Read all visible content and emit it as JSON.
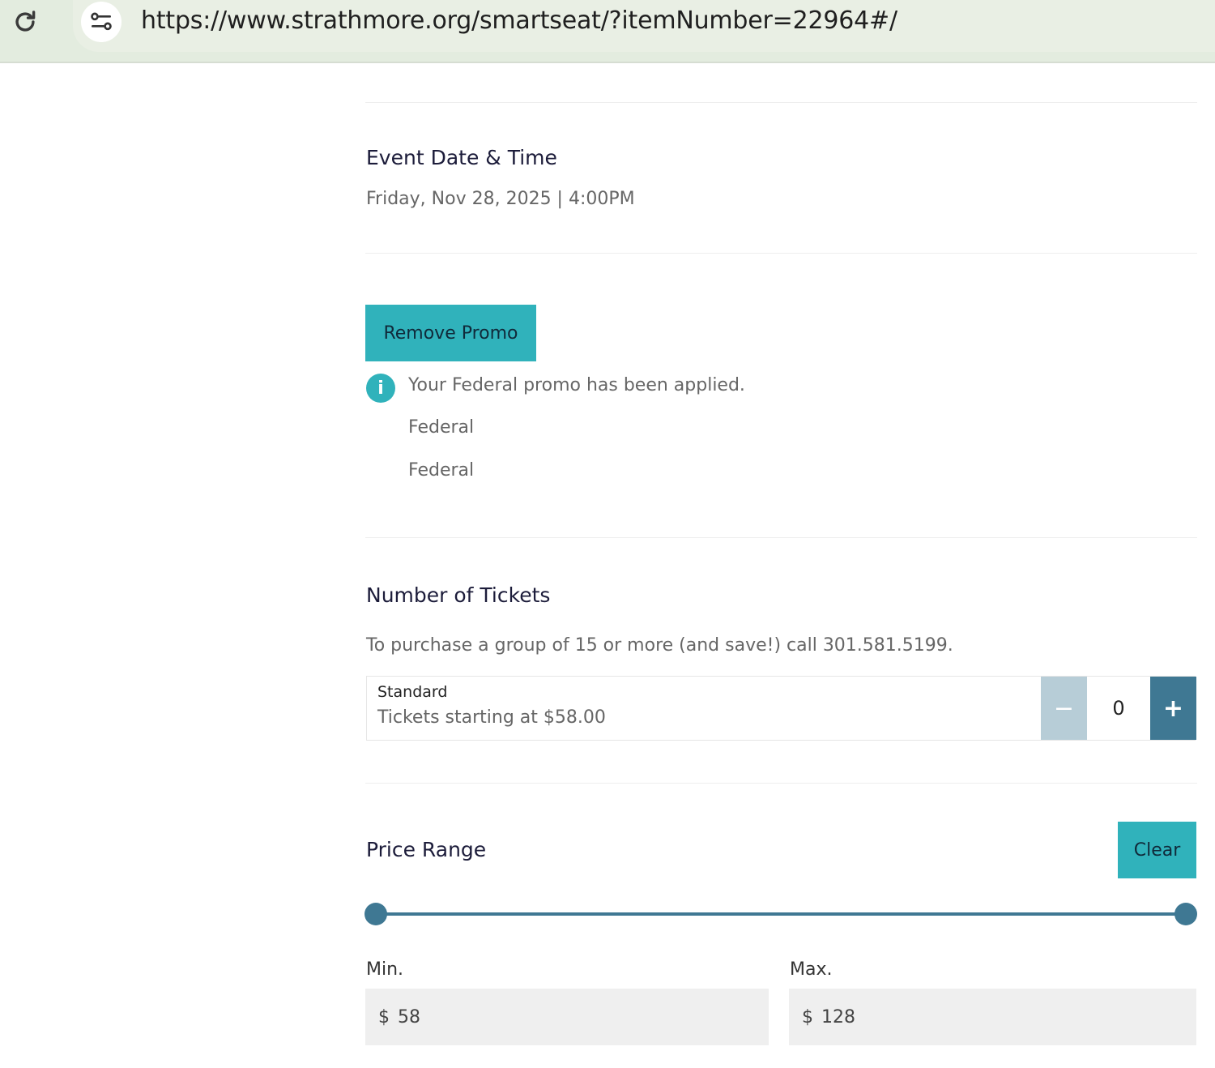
{
  "browser": {
    "url": "https://www.strathmore.org/smartseat/?itemNumber=22964#/"
  },
  "event": {
    "heading": "Event Date & Time",
    "datetime": "Friday, Nov 28, 2025 | 4:00PM"
  },
  "promo": {
    "button_label": "Remove Promo",
    "message": "Your Federal promo has been applied.",
    "codes": [
      "Federal",
      "Federal"
    ]
  },
  "tickets": {
    "heading": "Number of Tickets",
    "group_note": "To purchase a group of 15 or more (and save!) call 301.581.5199.",
    "row": {
      "name": "Standard",
      "subtitle": "Tickets starting at $58.00",
      "minus_label": "−",
      "plus_label": "+",
      "quantity": "0"
    }
  },
  "price_range": {
    "heading": "Price Range",
    "clear_label": "Clear",
    "min_label": "Min.",
    "max_label": "Max.",
    "currency": "$",
    "min_value": "58",
    "max_value": "128",
    "slider_min_fraction": 0,
    "slider_max_fraction": 1
  },
  "colors": {
    "teal": "#30b2bb",
    "slate_blue": "#3f7893",
    "disabled_blue": "#b7cdd7"
  },
  "icons": {
    "reload": "reload-icon",
    "site_info": "site-settings-icon",
    "info": "info-icon"
  }
}
